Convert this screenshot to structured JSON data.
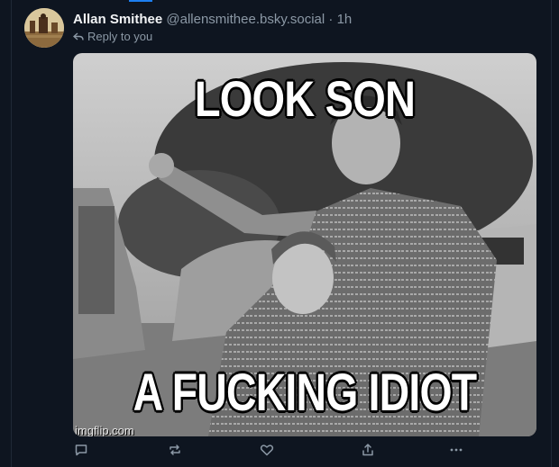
{
  "post": {
    "author_name": "Allan Smithee",
    "handle": "@allensmithee.bsky.social",
    "separator": "·",
    "time": "1h",
    "reply_context": "Reply to you"
  },
  "meme": {
    "top_text": "LOOK SON",
    "bottom_text": "A FUCKING IDIOT",
    "watermark": "imgflip.com"
  },
  "actions": [
    {
      "icon": "reply-icon"
    },
    {
      "icon": "repost-icon"
    },
    {
      "icon": "like-icon"
    },
    {
      "icon": "share-icon"
    },
    {
      "icon": "more-icon"
    }
  ],
  "colors": {
    "background": "#0e1520",
    "accent": "#1d7ff0",
    "muted": "#8b98a5"
  }
}
